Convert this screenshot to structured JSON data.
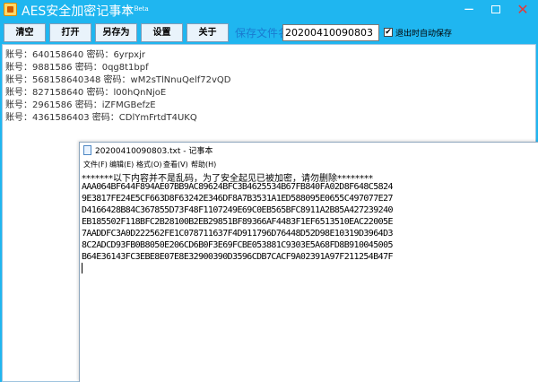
{
  "app": {
    "title": "AES安全加密记事本",
    "version": "1.0 Beta",
    "window_controls": {
      "minimize_icon": "−",
      "maximize_icon": "restore-icon",
      "close_icon": "✕"
    }
  },
  "toolbar": {
    "clear_label": "清空",
    "open_label": "打开",
    "save_as_label": "另存为",
    "settings_label": "设置",
    "about_label": "关于",
    "save_name_label": "保存文件名:",
    "save_name_value": "20200410090803",
    "autosave_label": "退出时自动保存",
    "autosave_checked": "✔"
  },
  "accounts": [
    "账号：640158640 密码：6yrpxjr",
    "账号：9881586 密码：0qg8t1bpf",
    "账号：568158640348 密码：wM2sTlNnuQelf72vQD",
    "账号：827158640 密码：l00hQnNjoE",
    "账号：2961586 密码：iZFMGBefzE",
    "账号：4361586403 密码：CDlYmFrtdT4UKQ"
  ],
  "notepad": {
    "title": "20200410090803.txt - 记事本",
    "menu": [
      "文件(F)",
      "编辑(E)",
      "格式(O)",
      "查看(V)",
      "帮助(H)"
    ],
    "lines": [
      "*******以下内容并不是乱码，为了安全起见已被加密，请勿删除********",
      "AAA064BF644F894AE07BB9AC89624BFC3B4625534B67FB840FA02D8F648C5824",
      "9E3817FE24E5CF663D8F63242E346DF8A7B3531A1ED588095E0655C497077E27",
      "D4166428B84C367855D73F48F1107249E69C0EB565BFC8911A2B85A427239240",
      "EB185502F118BFC2B28100B2EB29851BF89366AF4483F1EF6513510EAC22005E",
      "7AADDFC3A0D222562FE1C078711637F4D911796D76448D52D98E10319D3964D3",
      "8C2ADCD93FB0B8050E206CD6B0F3E69FCBE053881C9303E5A68FD8B910045005",
      "B64E36143FC3EBE8E07E8E32900390D3596CDB7CACF9A02391A97F211254B47F"
    ]
  }
}
